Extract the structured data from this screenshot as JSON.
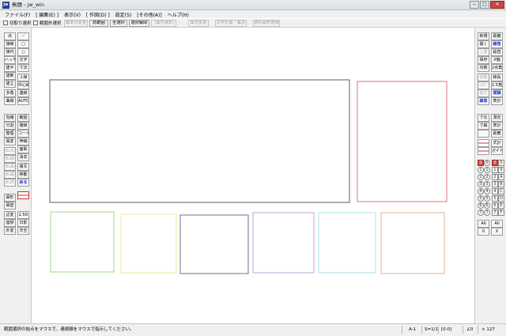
{
  "window": {
    "icon": "jw",
    "title": "無題 - jw_win",
    "controls": {
      "minimize": "−",
      "maximize": "□",
      "close": "✕"
    }
  },
  "menu": {
    "items": [
      "ファイル(F)",
      "[ 編集(E) ]",
      "表示(V)",
      "[ 作図(D) ]",
      "設定(S)",
      "[その他(A)]",
      "ヘルプ(H)"
    ]
  },
  "commandbar": {
    "checkboxes": [
      "切取り選択",
      "範囲外選択"
    ],
    "buttons": [
      {
        "label": "基準点変更",
        "enabled": false
      },
      {
        "label": "前範囲",
        "enabled": true
      },
      {
        "label": "全選択",
        "enabled": true
      },
      {
        "label": "選択解除",
        "enabled": true
      },
      {
        "label": "〈属性選択〉",
        "enabled": false
      },
      {
        "label": "属性変更",
        "enabled": false
      },
      {
        "label": "文字位置・集計",
        "enabled": false
      },
      {
        "label": "選択図形登録",
        "enabled": false
      }
    ]
  },
  "left_toolbar": {
    "col_a": [
      "点",
      "接線",
      "接円",
      "ハッチ",
      "建平",
      "建断",
      "建立",
      "多角",
      "曲線",
      "包絡",
      "分割",
      "整理",
      "属変",
      "BL化",
      "BL解",
      "BL属",
      "BL編",
      "BL終",
      "図形",
      "図登",
      "記変",
      "座標",
      "外変"
    ],
    "col_b": [
      "／",
      "□",
      "○",
      "文字",
      "寸法",
      "２線",
      "中心線",
      "連線",
      "AUTO",
      "範囲",
      "複線",
      "コーナー",
      "伸縮",
      "面取",
      "消去",
      "複写",
      "移動",
      "戻る",
      "2.5D",
      "日影",
      "天空"
    ]
  },
  "right_toolbar": {
    "col_a": [
      "新規",
      "開く",
      "上書",
      "保存",
      "印刷",
      "切取",
      "コピー",
      "貼付",
      "線角",
      "寸化",
      "寸解",
      "",
      "AII",
      "0"
    ],
    "col_b": [
      "距離",
      "線角",
      "鉛直",
      "X軸",
      "2点角",
      "線長",
      "2.5角",
      "間隔",
      "表計",
      "測定",
      "表計",
      "距離",
      "式計",
      "ガイド",
      "AII",
      "X"
    ],
    "layer_buttons": [
      [
        "0",
        "0",
        "0",
        "0"
      ],
      [
        "1",
        "1",
        "1",
        "9"
      ],
      [
        "2",
        "2",
        "2",
        "A"
      ],
      [
        "3",
        "3",
        "3",
        "B"
      ],
      [
        "4",
        "4",
        "4",
        "C"
      ],
      [
        "5",
        "5",
        "5",
        "D"
      ],
      [
        "6",
        "6",
        "6",
        "E"
      ],
      [
        "7",
        "7",
        "7",
        "F"
      ]
    ]
  },
  "drawing": {
    "shapes": [
      {
        "name": "large-rectangle",
        "color": "#333333"
      },
      {
        "name": "red-rectangle",
        "color": "#d9505a"
      },
      {
        "name": "green-rectangle",
        "color": "#88d060"
      },
      {
        "name": "yellow-rectangle",
        "color": "#e6e67a"
      },
      {
        "name": "navy-rectangle",
        "color": "#4a4e7e"
      },
      {
        "name": "purple-rectangle",
        "color": "#b28ccc"
      },
      {
        "name": "cyan-rectangle",
        "color": "#8ce0e8"
      },
      {
        "name": "orange-rectangle",
        "color": "#e0a070"
      }
    ]
  },
  "status": {
    "message": "範囲選択の始点をマウスで、連続線をマウスで指示してください。",
    "paper": "A-1",
    "scale": "S=1/1",
    "layer": "[0-0]",
    "angle": "∠0",
    "zoom": "× 127"
  }
}
